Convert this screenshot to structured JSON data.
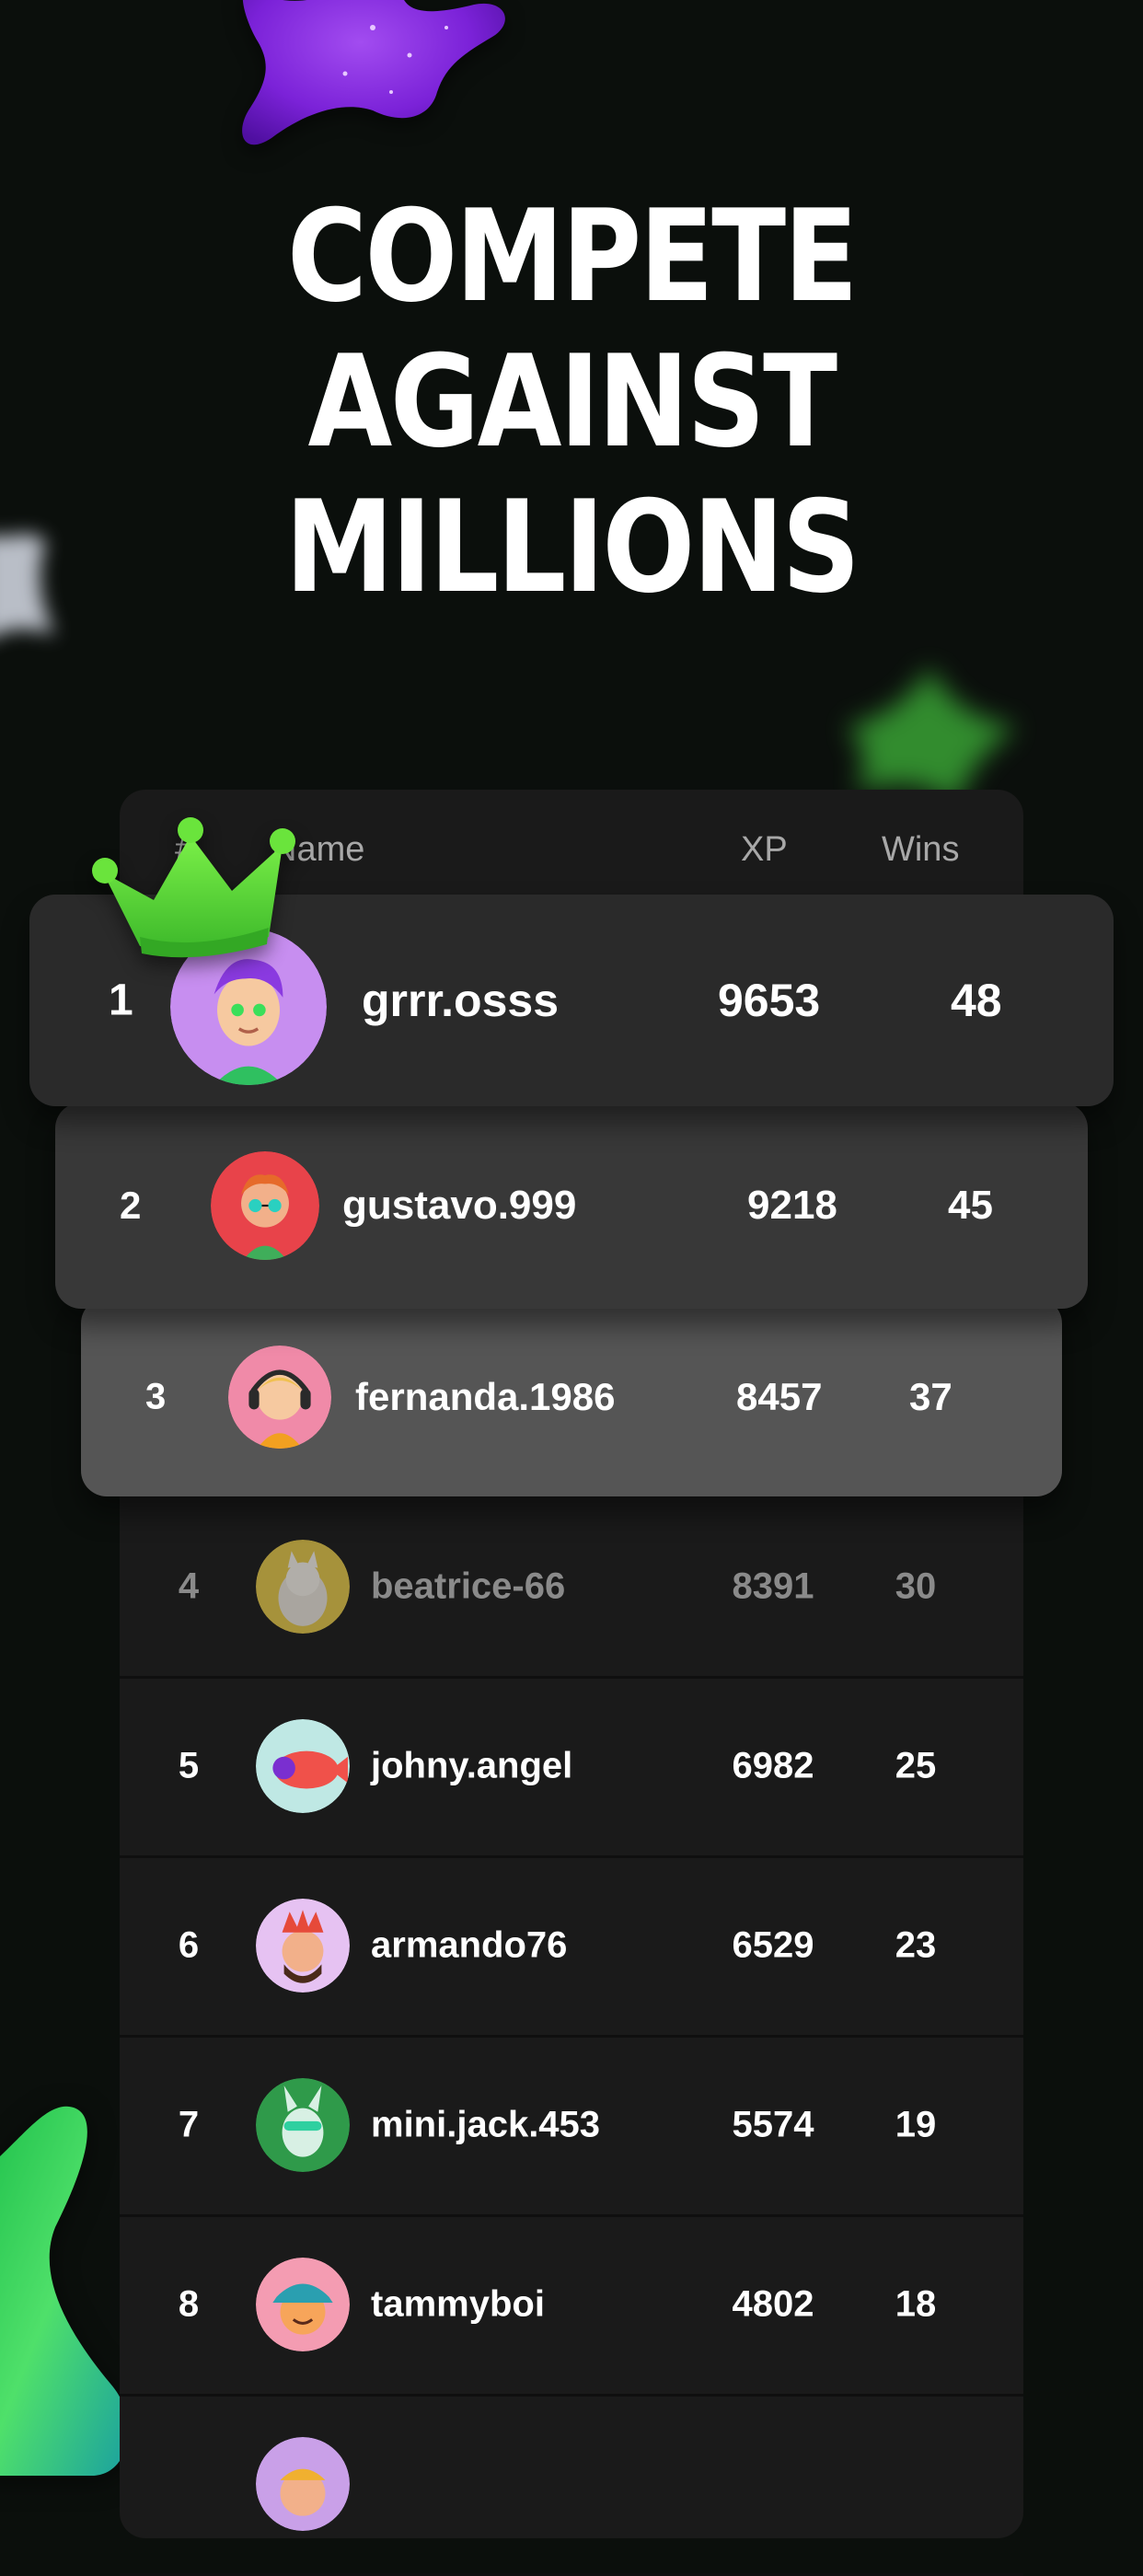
{
  "headline": {
    "line1": "COMPETE",
    "line2": "AGAINST",
    "line3": "MILLIONS"
  },
  "leaderboard": {
    "columns": {
      "rank": "#",
      "name": "Name",
      "xp": "XP",
      "wins": "Wins"
    },
    "top": [
      {
        "rank": "1",
        "name": "grrr.osss",
        "xp": "9653",
        "wins": "48",
        "avatar_bg": "#c78ef0"
      },
      {
        "rank": "2",
        "name": "gustavo.999",
        "xp": "9218",
        "wins": "45",
        "avatar_bg": "#e8434a"
      },
      {
        "rank": "3",
        "name": "fernanda.1986",
        "xp": "8457",
        "wins": "37",
        "avatar_bg": "#f08aa8"
      }
    ],
    "rows": [
      {
        "rank": "4",
        "name": "beatrice-66",
        "xp": "8391",
        "wins": "30",
        "avatar_bg": "#e2c54a"
      },
      {
        "rank": "5",
        "name": "johny.angel",
        "xp": "6982",
        "wins": "25",
        "avatar_bg": "#bfe8e4"
      },
      {
        "rank": "6",
        "name": "armando76",
        "xp": "6529",
        "wins": "23",
        "avatar_bg": "#e6c2f2"
      },
      {
        "rank": "7",
        "name": "mini.jack.453",
        "xp": "5574",
        "wins": "19",
        "avatar_bg": "#2f9a4a"
      },
      {
        "rank": "8",
        "name": "tammyboi",
        "xp": "4802",
        "wins": "18",
        "avatar_bg": "#f49cb2"
      },
      {
        "rank": "",
        "name": "",
        "xp": "",
        "wins": "",
        "avatar_bg": "#c9a0e8"
      }
    ]
  },
  "colors": {
    "background": "#0b0f0c",
    "panel": "#1a1a1a",
    "first_card": "#2a2a2a",
    "second_card": "#383838",
    "third_card": "#555555",
    "accent_green": "#5de23a",
    "accent_purple": "#8a2be2"
  }
}
